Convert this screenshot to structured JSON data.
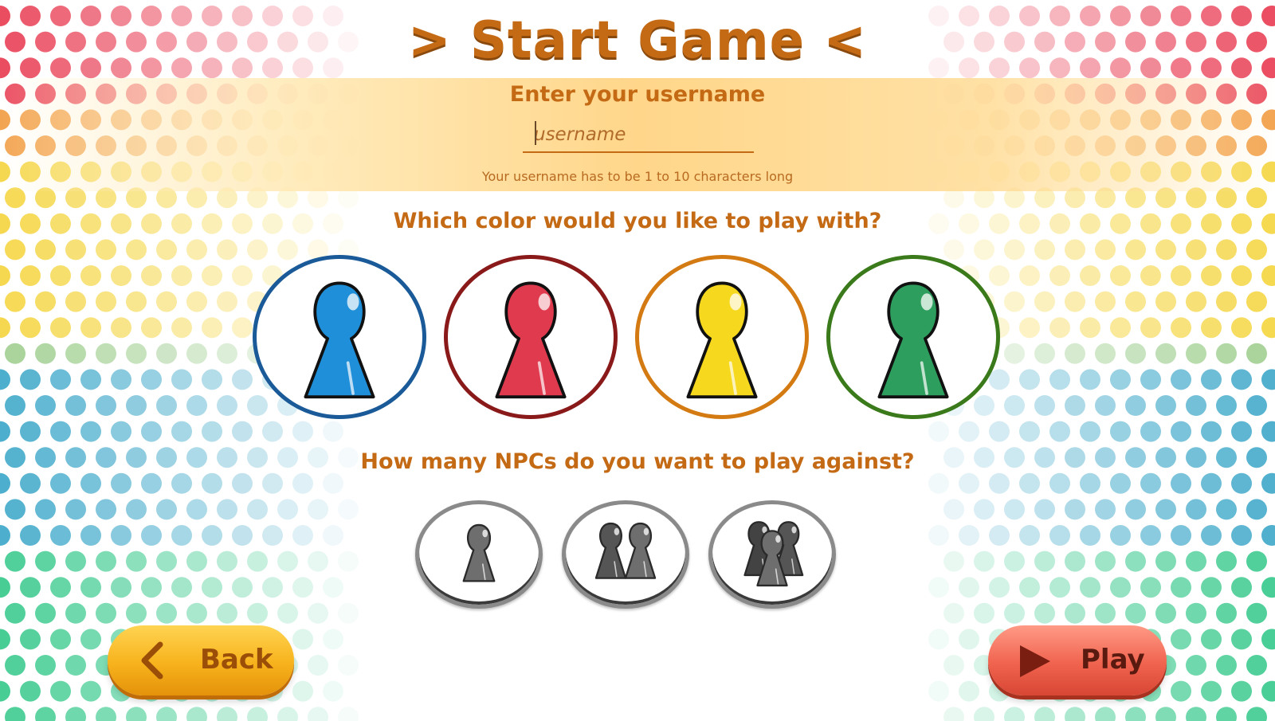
{
  "screen": {
    "title": "> Start Game <"
  },
  "username": {
    "label": "Enter your username",
    "placeholder": "username",
    "value": "",
    "hint": "Your username has to be 1 to 10 characters long"
  },
  "color_choice": {
    "question": "Which color would you like to play with?",
    "options": [
      {
        "id": "blue",
        "icon": "blue-pawn-icon",
        "fill": "#1e8fd8",
        "ring": "#1a5a98"
      },
      {
        "id": "red",
        "icon": "red-pawn-icon",
        "fill": "#e03a4e",
        "ring": "#8a1a1a"
      },
      {
        "id": "yellow",
        "icon": "yellow-pawn-icon",
        "fill": "#f6d81e",
        "ring": "#d47a12"
      },
      {
        "id": "green",
        "icon": "green-pawn-icon",
        "fill": "#2e9e5e",
        "ring": "#3a7a1a"
      }
    ]
  },
  "npc_choice": {
    "question": "How many NPCs do you want to play against?",
    "options": [
      {
        "count": 1,
        "icon": "one-grey-pawn-icon"
      },
      {
        "count": 2,
        "icon": "two-grey-pawns-icon"
      },
      {
        "count": 3,
        "icon": "three-grey-pawns-icon"
      }
    ]
  },
  "buttons": {
    "back": {
      "label": "Back",
      "icon": "chevron-left-icon"
    },
    "play": {
      "label": "Play",
      "icon": "play-triangle-icon"
    }
  },
  "colors": {
    "accent": "#c46a14",
    "back_button": "#f7b21c",
    "play_button": "#f0634e"
  }
}
